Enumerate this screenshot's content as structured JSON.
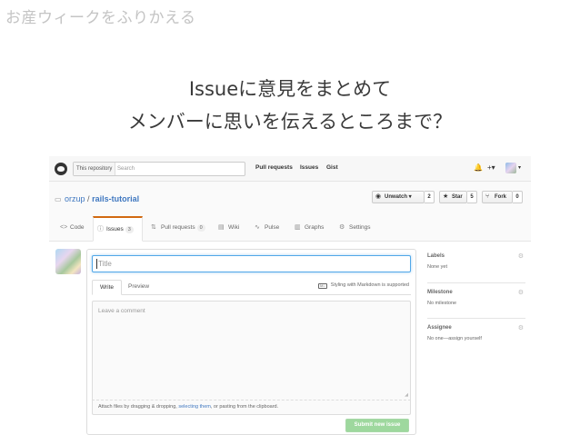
{
  "slide": {
    "deck_title": "お産ウィークをふりかえる",
    "heading_line1": "Issueに意見をまとめて",
    "heading_line2": "メンバーに思いを伝えるところまで？"
  },
  "header": {
    "search_scope": "This repository",
    "search_placeholder": "Search",
    "nav": [
      "Pull requests",
      "Issues",
      "Gist"
    ],
    "plus_label": "+▾",
    "bell_icon": "bell-icon"
  },
  "repo": {
    "owner": "orzup",
    "separator": "/",
    "name": "rails-tutorial",
    "actions": {
      "unwatch_label": "Unwatch ▾",
      "unwatch_count": "2",
      "star_label": "Star",
      "star_count": "5",
      "fork_label": "Fork",
      "fork_count": "0"
    },
    "tabs": [
      {
        "label": "Code",
        "icon": "<>"
      },
      {
        "label": "Issues",
        "icon": "ⓘ",
        "count": "3"
      },
      {
        "label": "Pull requests",
        "icon": "⇅",
        "count": "0"
      },
      {
        "label": "Wiki",
        "icon": "▤"
      },
      {
        "label": "Pulse",
        "icon": "∿"
      },
      {
        "label": "Graphs",
        "icon": "▥"
      },
      {
        "label": "Settings",
        "icon": "⚙"
      }
    ]
  },
  "form": {
    "title_placeholder": "Title",
    "write_tab": "Write",
    "preview_tab": "Preview",
    "markdown_hint": "Styling with Markdown is supported",
    "comment_placeholder": "Leave a comment",
    "attach_before": "Attach files by dragging & dropping, ",
    "attach_link": "selecting them",
    "attach_after": ", or pasting from the clipboard.",
    "submit_label": "Submit new issue"
  },
  "sidebar": {
    "labels_title": "Labels",
    "labels_value": "None yet",
    "milestone_title": "Milestone",
    "milestone_value": "No milestone",
    "assignee_title": "Assignee",
    "assignee_value": "No one—assign yourself"
  },
  "colors": {
    "link": "#4078c0",
    "tab_accent": "#d26911",
    "submit_disabled": "#9ed89e",
    "focus": "#51a7e8"
  }
}
